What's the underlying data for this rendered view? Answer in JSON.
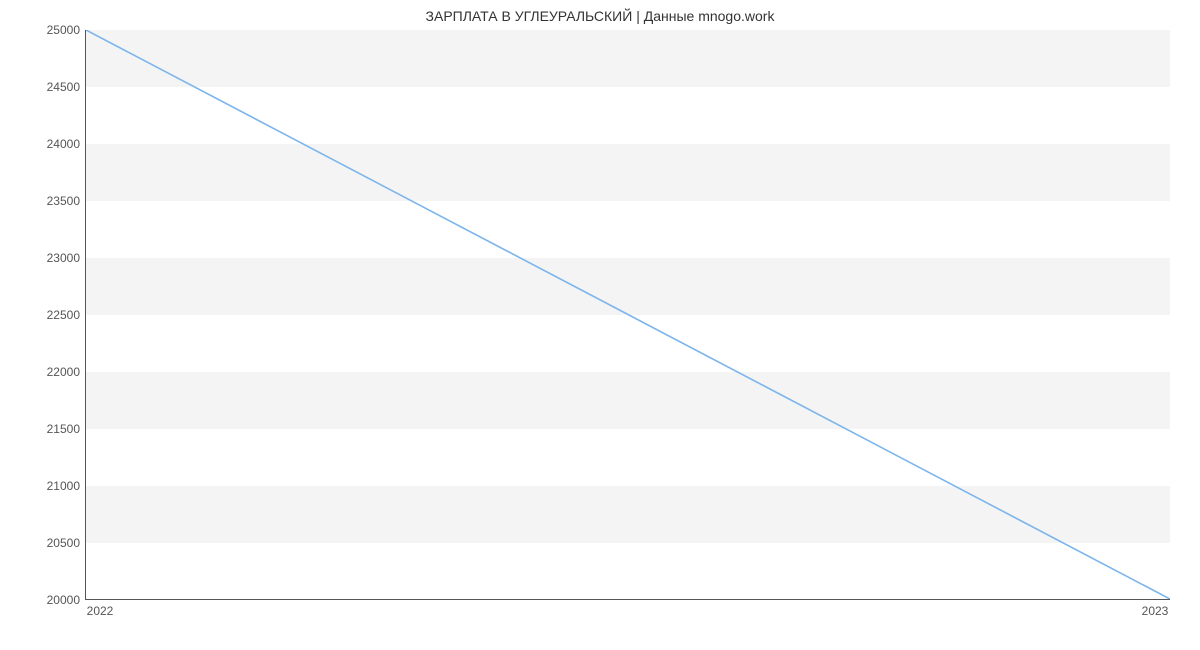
{
  "chart_data": {
    "type": "line",
    "title": "ЗАРПЛАТА В УГЛЕУРАЛЬСКИЙ | Данные mnogo.work",
    "x": [
      2022,
      2023
    ],
    "values": [
      25000,
      20000
    ],
    "xlabel": "",
    "ylabel": "",
    "xlim": [
      2022,
      2023
    ],
    "ylim": [
      20000,
      25000
    ],
    "xticks": [
      2022,
      2023
    ],
    "yticks": [
      20000,
      20500,
      21000,
      21500,
      22000,
      22500,
      23000,
      23500,
      24000,
      24500,
      25000
    ],
    "line_color": "#7cb5ec",
    "grid": "banded"
  }
}
